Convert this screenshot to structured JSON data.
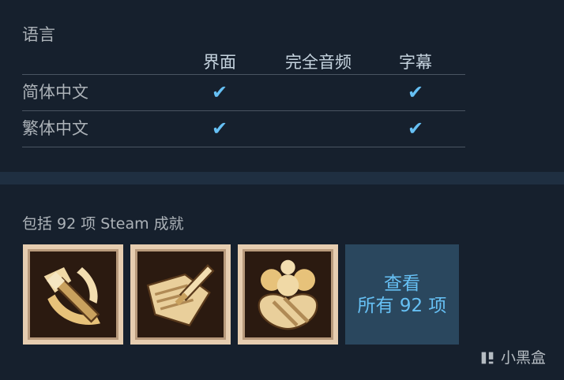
{
  "languages": {
    "title": "语言",
    "columns": [
      "界面",
      "完全音频",
      "字幕"
    ],
    "rows": [
      {
        "name": "简体中文",
        "interface": true,
        "full_audio": false,
        "subtitles": true
      },
      {
        "name": "繁体中文",
        "interface": true,
        "full_audio": false,
        "subtitles": true
      }
    ],
    "check_glyph": "✔"
  },
  "achievements": {
    "title": "包括 92 项 Steam 成就",
    "icons": [
      "sword-claw-icon",
      "map-sword-icon",
      "potion-orbs-icon"
    ],
    "view_all": {
      "line1": "查看",
      "line2": "所有 92 项"
    }
  },
  "watermark": {
    "text": "小黑盒",
    "icon": "xiaoheihe-logo-icon"
  },
  "colors": {
    "accent": "#66c0f4",
    "background": "#1b2838",
    "panel": "#16202d",
    "view_all_bg": "#2a475e"
  }
}
